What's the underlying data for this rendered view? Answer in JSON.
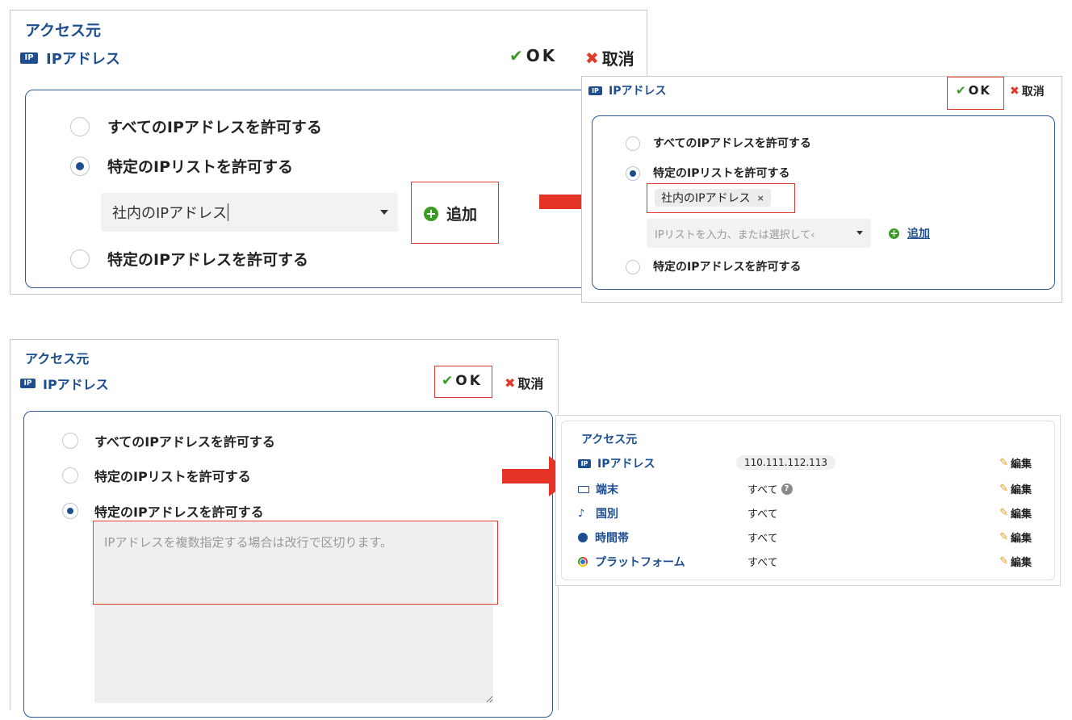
{
  "panel1": {
    "section_title": "アクセス元",
    "ip_badge": "IP",
    "ip_title": "IPアドレス",
    "ok_label": "OK",
    "cancel_label": "取消",
    "options": [
      "すべてのIPアドレスを許可する",
      "特定のIPリストを許可する",
      "特定のIPアドレスを許可する"
    ],
    "selected_option": 1,
    "select_value": "社内のIPアドレス",
    "add_label": "追加"
  },
  "panel2": {
    "ip_badge": "IP",
    "ip_title": "IPアドレス",
    "ok_label": "OK",
    "cancel_label": "取消",
    "options": [
      "すべてのIPアドレスを許可する",
      "特定のIPリストを許可する",
      "特定のIPアドレスを許可する"
    ],
    "selected_option": 1,
    "chip_label": "社内のIPアドレス",
    "chip_remove": "×",
    "select_placeholder": "IPリストを入力、または選択して‹",
    "add_label": "追加"
  },
  "panel3": {
    "section_title": "アクセス元",
    "ip_badge": "IP",
    "ip_title": "IPアドレス",
    "ok_label": "OK",
    "cancel_label": "取消",
    "options": [
      "すべてのIPアドレスを許可する",
      "特定のIPリストを許可する",
      "特定のIPアドレスを許可する"
    ],
    "selected_option": 2,
    "textarea_placeholder": "IPアドレスを複数指定する場合は改行で区切ります。"
  },
  "panel4": {
    "section_title": "アクセス元",
    "rows": [
      {
        "icon": "ip-badge-icon",
        "badge": "IP",
        "label": "IPアドレス",
        "value": "110.111.112.113",
        "edit": "編集"
      },
      {
        "icon": "device-icon",
        "label": "端末",
        "value": "すべて",
        "edit": "編集"
      },
      {
        "icon": "country-icon",
        "label": "国別",
        "value": "すべて",
        "edit": "編集"
      },
      {
        "icon": "clock-icon",
        "label": "時間帯",
        "value": "すべて",
        "edit": "編集"
      },
      {
        "icon": "chrome-icon",
        "label": "プラットフォーム",
        "value": "すべて",
        "edit": "編集"
      }
    ]
  },
  "colors": {
    "brand_blue": "#1d4e8f",
    "ok_green": "#3a9b22",
    "cancel_red": "#e03a2b",
    "arrow_red": "#e53325",
    "edit_pencil": "#e0a020"
  }
}
